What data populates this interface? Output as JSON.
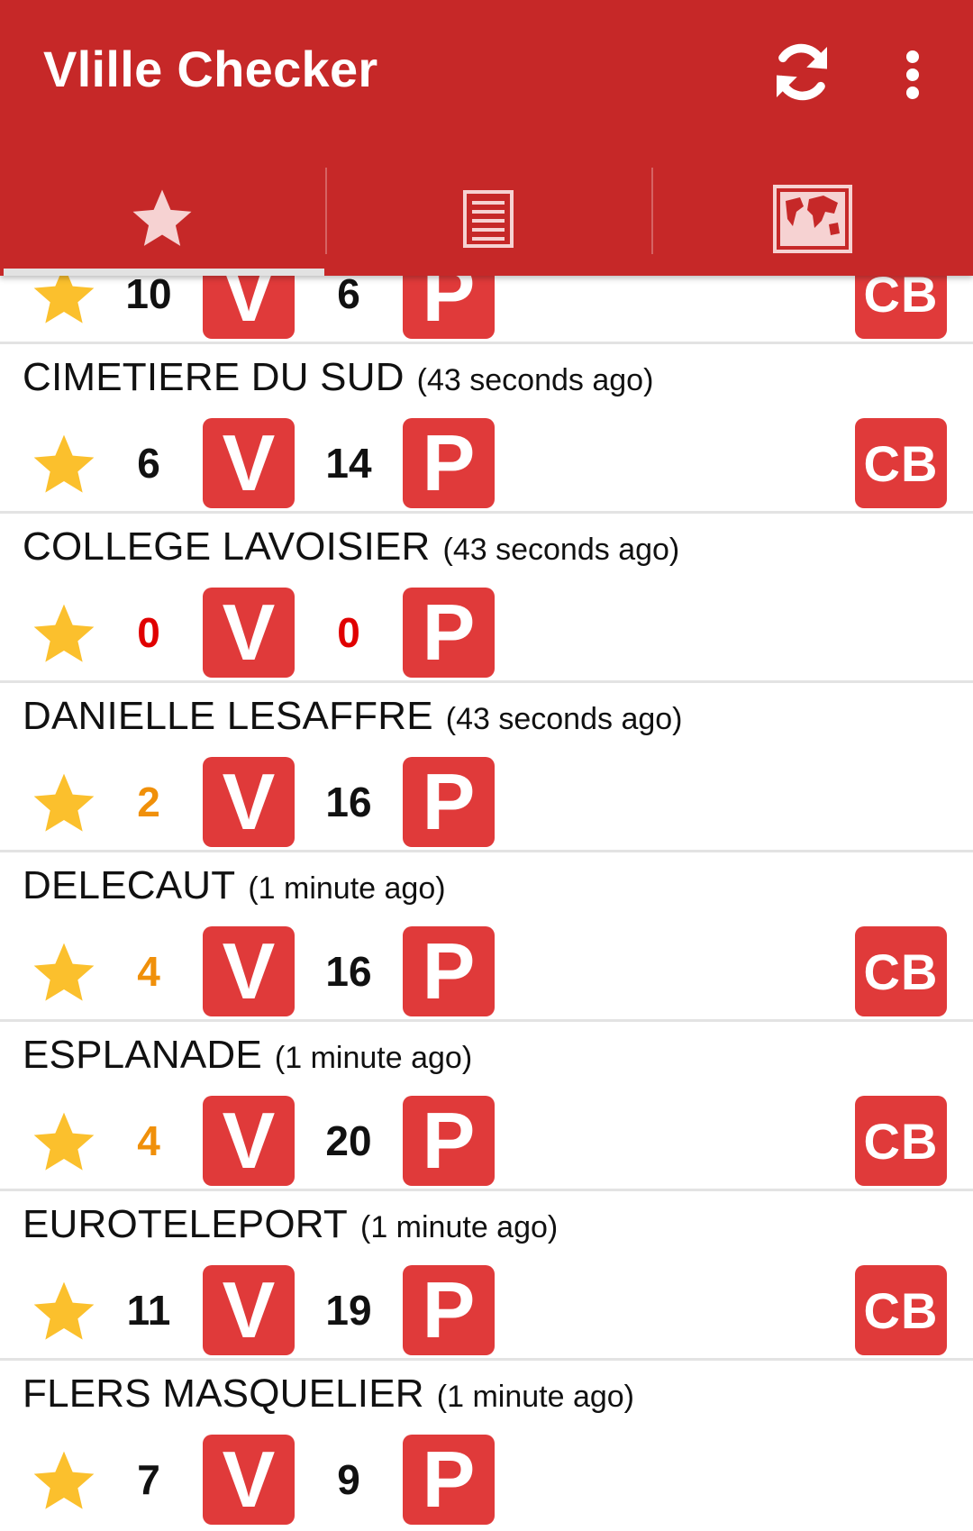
{
  "app": {
    "title": "Vlille Checker",
    "accent": "#c62828",
    "badge_color": "#e03a3a",
    "actions": [
      "refresh-icon",
      "overflow-menu-icon"
    ]
  },
  "tabs": [
    {
      "icon": "star-icon",
      "selected": true
    },
    {
      "icon": "list-icon",
      "selected": false
    },
    {
      "icon": "map-icon",
      "selected": false
    }
  ],
  "labels": {
    "bikes_badge": "V",
    "stands_badge": "P",
    "card_badge": "CB"
  },
  "stations": [
    {
      "name": "",
      "updated": "",
      "bikes": "10",
      "stands": "6",
      "card": true,
      "partial": true
    },
    {
      "name": "CIMETIERE DU SUD",
      "updated": "(43 seconds ago)",
      "bikes": "6",
      "stands": "14",
      "card": true
    },
    {
      "name": "COLLEGE LAVOISIER",
      "updated": "(43 seconds ago)",
      "bikes": "0",
      "stands": "0",
      "card": false
    },
    {
      "name": "DANIELLE LESAFFRE",
      "updated": "(43 seconds ago)",
      "bikes": "2",
      "stands": "16",
      "card": false
    },
    {
      "name": "DELECAUT",
      "updated": "(1 minute ago)",
      "bikes": "4",
      "stands": "16",
      "card": true
    },
    {
      "name": "ESPLANADE",
      "updated": "(1 minute ago)",
      "bikes": "4",
      "stands": "20",
      "card": true
    },
    {
      "name": "EUROTELEPORT",
      "updated": "(1 minute ago)",
      "bikes": "11",
      "stands": "19",
      "card": true
    },
    {
      "name": "FLERS MASQUELIER",
      "updated": "(1 minute ago)",
      "bikes": "7",
      "stands": "9",
      "card": false
    }
  ],
  "colors": {
    "zero": "#e00000",
    "low": "#f0900a",
    "star": "#fbc02d",
    "normal": "#111111"
  }
}
